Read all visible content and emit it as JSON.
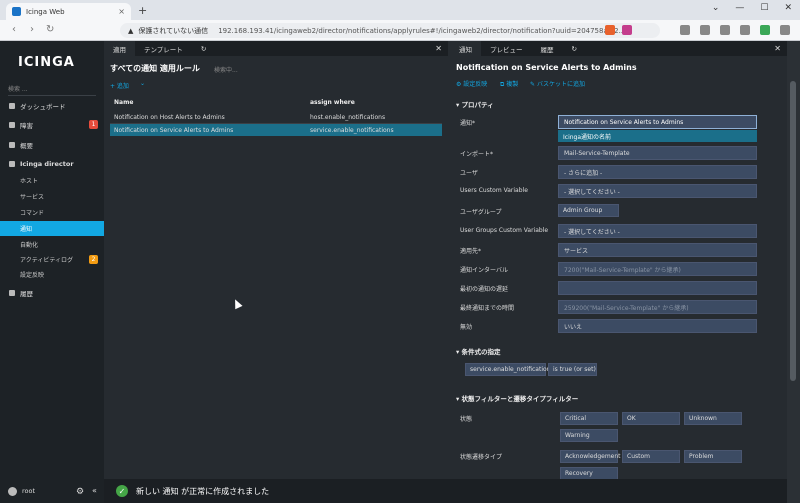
{
  "browser": {
    "tab_title": "Icinga Web",
    "tab_close": "×",
    "new_tab": "+",
    "window_controls": [
      "⌄",
      "—",
      "☐",
      "✕"
    ],
    "security_warning": "保護されていない通信",
    "url": "192.168.193.41/icingaweb2/director/notifications/applyrules#!/icingaweb2/director/notification?uuid=204758ac-2...",
    "nav": {
      "back": "‹",
      "forward": "›",
      "reload": "↻",
      "bookmark": "⌂"
    }
  },
  "sidebar": {
    "logo": "ICINGA",
    "search_placeholder": "検索 ...",
    "items": [
      {
        "label": "ダッシュボード"
      },
      {
        "label": "障害",
        "badge": "1"
      },
      {
        "label": "概要"
      },
      {
        "label": "Icinga director"
      },
      {
        "label": "ホスト"
      },
      {
        "label": "サービス"
      },
      {
        "label": "コマンド"
      },
      {
        "label": "通知"
      },
      {
        "label": "自動化"
      },
      {
        "label": "アクティビティログ",
        "badge": "2"
      },
      {
        "label": "設定反映"
      },
      {
        "label": "履歴"
      }
    ],
    "user": "root",
    "gear": "⚙",
    "collapse": "«"
  },
  "col1": {
    "tabs": [
      "適用",
      "テンプレート",
      "↻"
    ],
    "close": "✕",
    "title": "すべての通知 適用ルール",
    "search_placeholder": "検索中...",
    "add": "+ 追加",
    "more": "⌄",
    "headers": [
      "Name",
      "assign where"
    ],
    "rows": [
      [
        "Notification on Host Alerts to Admins",
        "host.enable_notifications"
      ],
      [
        "Notification on Service Alerts to Admins",
        "service.enable_notifications"
      ]
    ]
  },
  "col2": {
    "tabs": [
      "通知",
      "プレビュー",
      "履歴",
      "↻"
    ],
    "close": "✕",
    "title": "Notification on Service Alerts to Admins",
    "actions": [
      "設定反映",
      "複製",
      "バスケットに追加"
    ],
    "section_props": "▾ プロパティ",
    "fields": [
      {
        "label": "通知*",
        "value": "Notification on Service Alerts to Admins"
      },
      {
        "label": "インポート*",
        "value": "Mail-Service-Template"
      },
      {
        "label": "ユーザ",
        "value": "- さらに追加 -"
      },
      {
        "label": "Users Custom Variable",
        "value": "- 選択してください -"
      },
      {
        "label": "ユーザグループ",
        "value": "Admin Group"
      },
      {
        "label": "User Groups Custom Variable",
        "value": "- 選択してください -"
      },
      {
        "label": "適用先*",
        "value": "サービス"
      },
      {
        "label": "通知インターバル",
        "value": "7200(\"Mail-Service-Template\" から継承)"
      },
      {
        "label": "最初の通知の遅延",
        "value": ""
      },
      {
        "label": "最終通知までの時間",
        "value": "259200(\"Mail-Service-Template\" から継承)"
      },
      {
        "label": "無効",
        "value": "いいえ"
      }
    ],
    "dropdown_hint": "Icinga通知の名前",
    "section_cond": "▾ 条件式の指定",
    "cond_chips": [
      "service.enable_notifications",
      "is true (or set)"
    ],
    "section_filter": "▾ 状態フィルターと遷移タイプフィルター",
    "state_label": "状態",
    "states": [
      "Critical",
      "OK",
      "Unknown",
      "Warning"
    ],
    "trans_label": "状態遷移タイプ",
    "transitions": [
      "Acknowledgement",
      "Custom",
      "Problem",
      "Recovery"
    ]
  },
  "toast": {
    "icon": "✓",
    "message": "新しい 通知 が正常に作成されました"
  }
}
